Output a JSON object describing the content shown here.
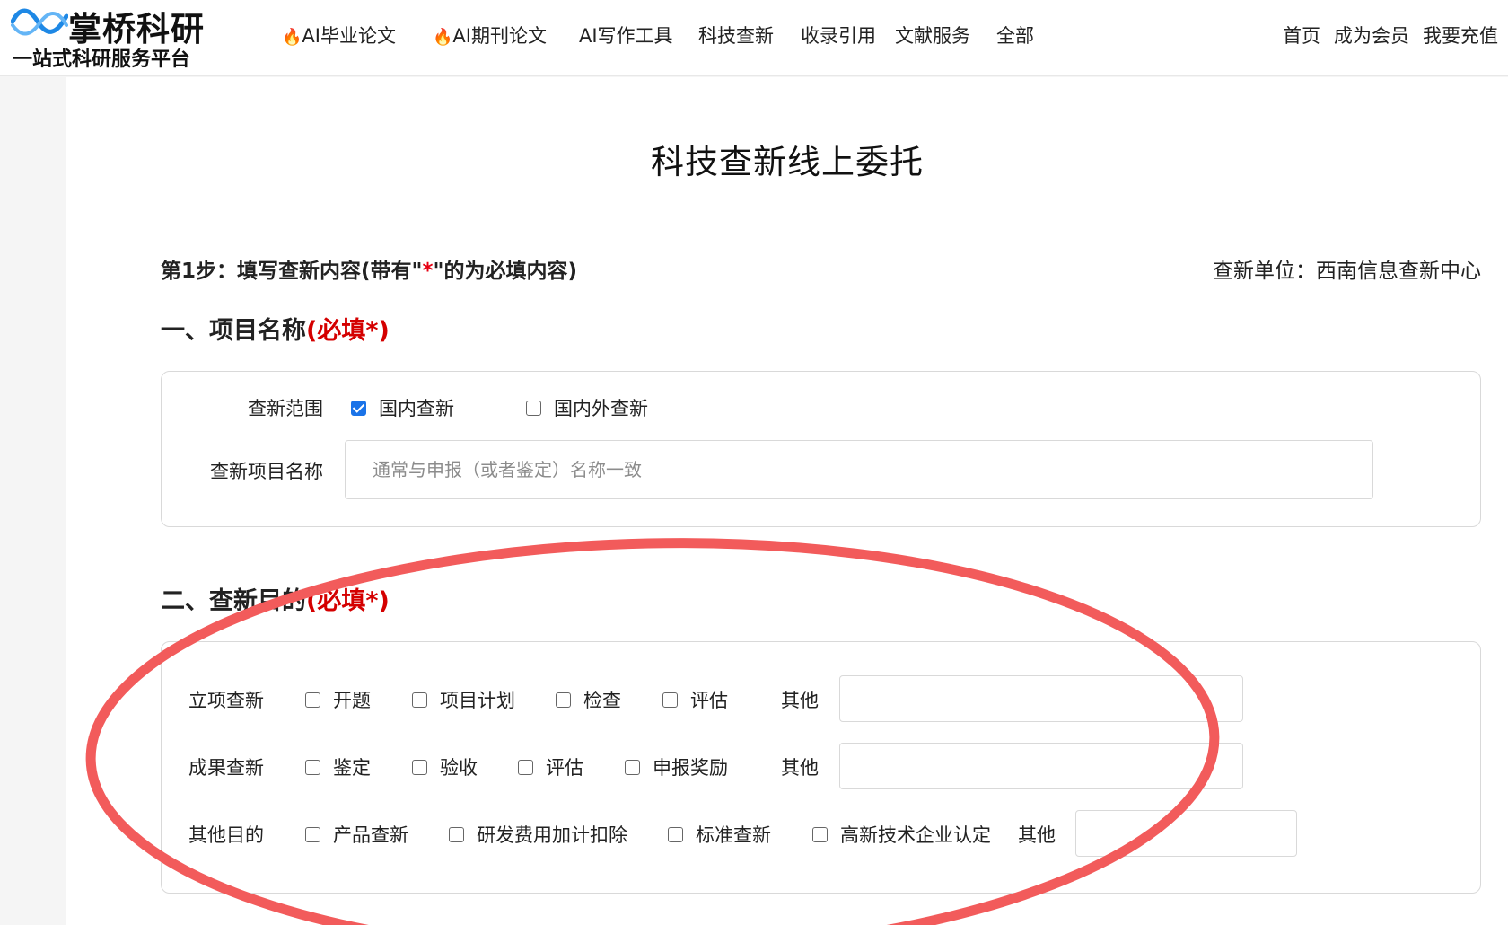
{
  "header": {
    "brand_name": "掌桥科研",
    "brand_slogan": "一站式科研服务平台",
    "fire_icon": "🔥",
    "nav": [
      {
        "label": "AI毕业论文",
        "hot": true
      },
      {
        "label": "AI期刊论文",
        "hot": true
      },
      {
        "label": "AI写作工具",
        "hot": false
      },
      {
        "label": "科技查新",
        "hot": false
      },
      {
        "label": "收录引用",
        "hot": false
      },
      {
        "label": "文献服务",
        "hot": false
      },
      {
        "label": "全部",
        "hot": false
      }
    ],
    "right_links": [
      "首页",
      "成为会员",
      "我要充值"
    ]
  },
  "page": {
    "title": "科技查新线上委托",
    "step_prefix": "第1步：填写查新内容(带有\"",
    "step_star": "*",
    "step_suffix": "\"的为必填内容)",
    "unit_label": "查新单位：西南信息查新中心"
  },
  "section1": {
    "heading": "一、项目名称",
    "required_mark": "(必填*)",
    "scope_label": "查新范围",
    "scope_options": [
      {
        "label": "国内查新",
        "checked": true
      },
      {
        "label": "国内外查新",
        "checked": false
      }
    ],
    "project_name_label": "查新项目名称",
    "project_name_placeholder": "通常与申报（或者鉴定）名称一致",
    "project_name_value": ""
  },
  "section2": {
    "heading": "二、查新目的",
    "required_mark": "(必填*)",
    "rows": [
      {
        "label": "立项查新",
        "options": [
          {
            "label": "开题",
            "checked": false
          },
          {
            "label": "项目计划",
            "checked": false
          },
          {
            "label": "检查",
            "checked": false
          },
          {
            "label": "评估",
            "checked": false
          }
        ],
        "other_label": "其他",
        "other_value": ""
      },
      {
        "label": "成果查新",
        "options": [
          {
            "label": "鉴定",
            "checked": false
          },
          {
            "label": "验收",
            "checked": false
          },
          {
            "label": "评估",
            "checked": false
          },
          {
            "label": "申报奖励",
            "checked": false
          }
        ],
        "other_label": "其他",
        "other_value": ""
      },
      {
        "label": "其他目的",
        "options": [
          {
            "label": "产品查新",
            "checked": false
          },
          {
            "label": "研发费用加计扣除",
            "checked": false
          },
          {
            "label": "标准查新",
            "checked": false
          },
          {
            "label": "高新技术企业认定",
            "checked": false
          }
        ],
        "other_label": "其他",
        "other_value": ""
      }
    ]
  },
  "colors": {
    "required_red": "#d40000",
    "annotation_red": "#f25b5b",
    "checkbox_blue": "#1a73e8",
    "logo_blue": "#1e88e5"
  }
}
